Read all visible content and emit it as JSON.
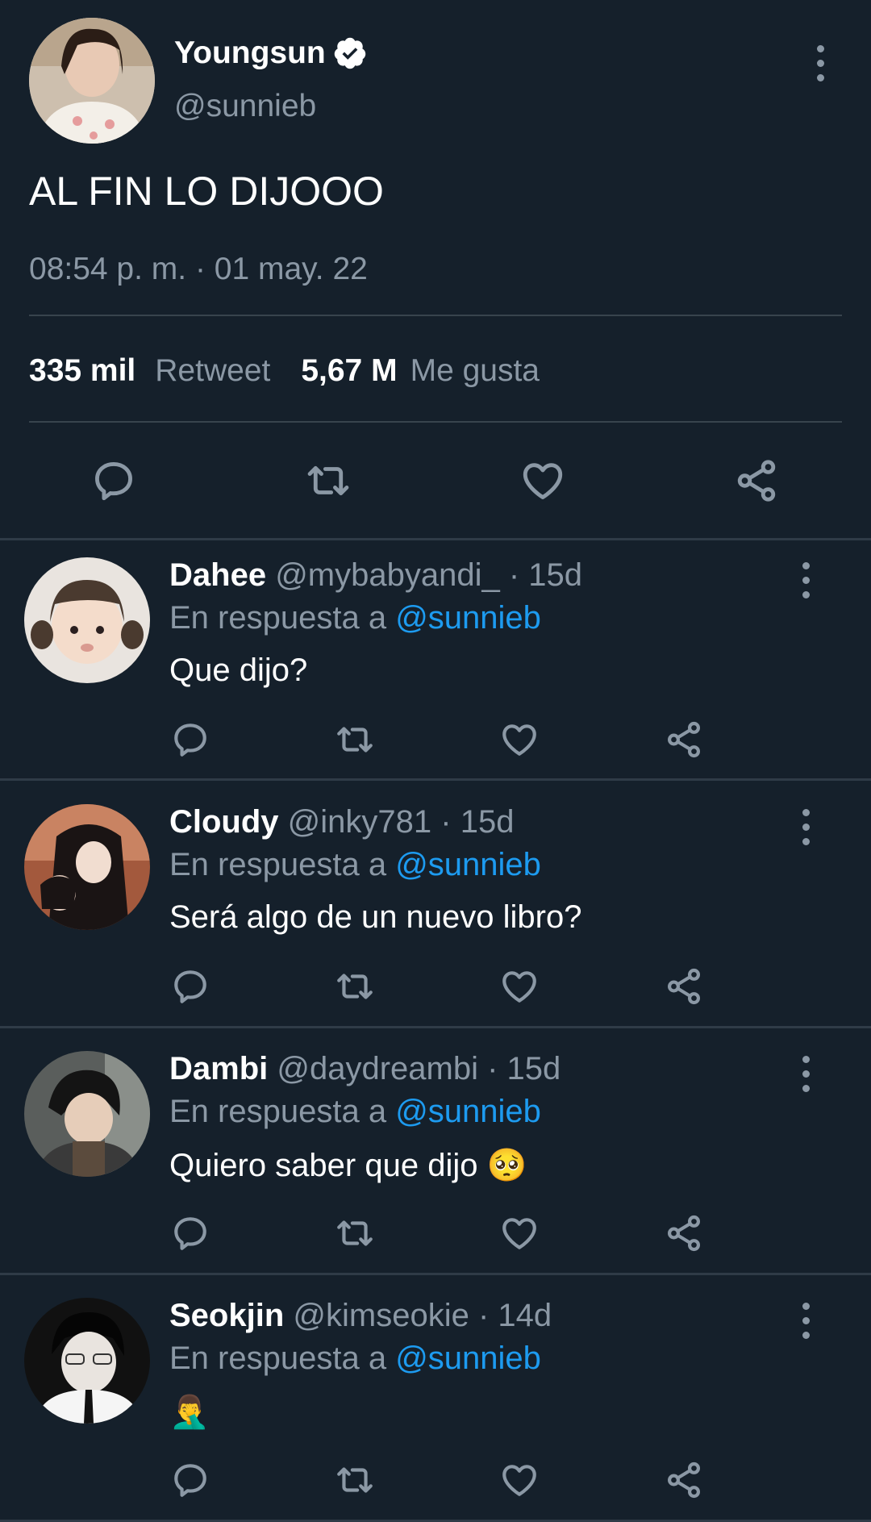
{
  "main_tweet": {
    "display_name": "Youngsun",
    "handle": "@sunnieb",
    "text": "AL FIN LO DIJOOO",
    "timestamp": "08:54 p. m. · 01 may. 22",
    "retweet_count": "335 mil",
    "retweet_label": "Retweet",
    "like_count": "5,67 M",
    "like_label": "Me gusta"
  },
  "replies": [
    {
      "name": "Dahee",
      "meta": "@mybabyandi_ · 15d",
      "reply_prefix": "En respuesta a",
      "mention": "@sunnieb",
      "text": "Que dijo?"
    },
    {
      "name": "Cloudy",
      "meta": "@inky781 · 15d",
      "reply_prefix": "En respuesta a",
      "mention": "@sunnieb",
      "text": "Será algo de un nuevo libro?"
    },
    {
      "name": "Dambi",
      "meta": "@daydreambi · 15d",
      "reply_prefix": "En respuesta a",
      "mention": "@sunnieb",
      "text": "Quiero saber que dijo 🥺"
    },
    {
      "name": "Seokjin",
      "meta": "@kimseokie · 14d",
      "reply_prefix": "En respuesta a",
      "mention": "@sunnieb",
      "text": "🤦‍♂️"
    }
  ],
  "colors": {
    "background": "#15202b",
    "secondary_text": "#8b98a5",
    "link": "#1d9bf0",
    "verified_badge": "#ffffff"
  },
  "icons": [
    "verified-badge-icon",
    "more-icon",
    "reply-icon",
    "retweet-icon",
    "like-icon",
    "share-icon"
  ]
}
